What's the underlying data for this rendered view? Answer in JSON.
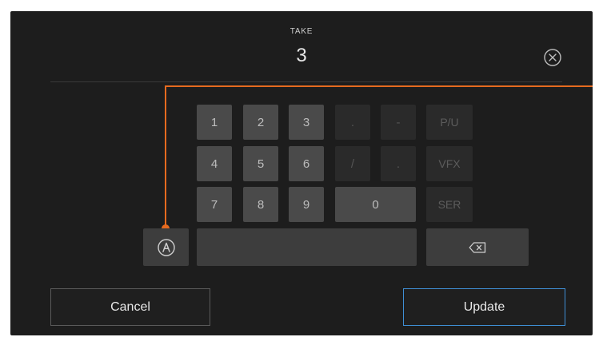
{
  "field": {
    "label": "TAKE",
    "value": "3"
  },
  "keypad": {
    "row1": [
      "1",
      "2",
      "3",
      ".",
      "-",
      "P/U"
    ],
    "row2": [
      "4",
      "5",
      "6",
      "/",
      ".",
      "VFX"
    ],
    "row3": [
      "7",
      "8",
      "9",
      "0",
      "SER"
    ]
  },
  "icons": {
    "clear": "close-circle-icon",
    "toggle": "letter-a-circle-icon",
    "backspace": "backspace-icon"
  },
  "buttons": {
    "cancel": "Cancel",
    "update": "Update"
  },
  "colors": {
    "accent": "#e66a1f",
    "primary_border": "#3f8fd6",
    "background": "#1d1d1d"
  }
}
